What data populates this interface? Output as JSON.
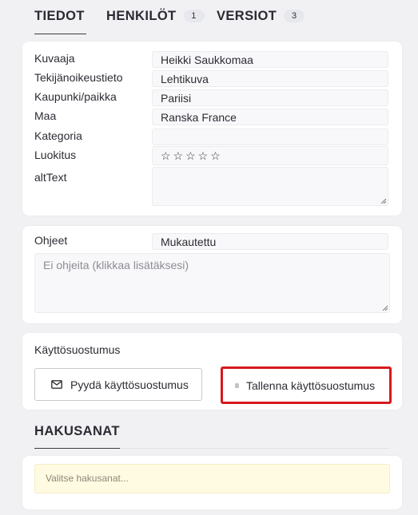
{
  "tabs": [
    {
      "label": "TIEDOT",
      "count": null
    },
    {
      "label": "HENKILÖT",
      "count": "1"
    },
    {
      "label": "VERSIOT",
      "count": "3"
    }
  ],
  "details": {
    "photographer_label": "Kuvaaja",
    "photographer_value": "Heikki Saukkomaa",
    "copyright_label": "Tekijänoikeustieto",
    "copyright_value": "Lehtikuva",
    "city_label": "Kaupunki/paikka",
    "city_value": "Pariisi",
    "country_label": "Maa",
    "country_value": "Ranska France",
    "category_label": "Kategoria",
    "category_value": "",
    "rating_label": "Luokitus",
    "rating_stars": "☆☆☆☆☆",
    "rating_value": 0,
    "rating_max": 5,
    "alttext_label": "altText",
    "alttext_value": ""
  },
  "instructions": {
    "label": "Ohjeet",
    "mode_value": "Mukautettu",
    "placeholder": "Ei ohjeita (klikkaa lisätäksesi)"
  },
  "consent": {
    "label": "Käyttösuostumus",
    "request_button": "Pyydä käyttösuostumus",
    "save_button": "Tallenna käyttösuostumus",
    "highlight_color": "#d7191c"
  },
  "keywords": {
    "title": "HAKUSANAT",
    "placeholder": "Valitse hakusanat..."
  }
}
